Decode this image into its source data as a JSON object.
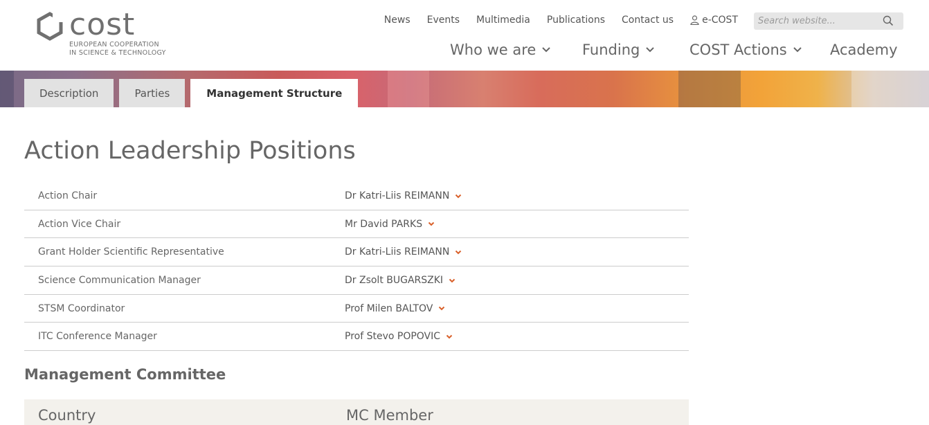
{
  "logo": {
    "wordmark": "cost",
    "subtitle_line1": "EUROPEAN COOPERATION",
    "subtitle_line2": "IN SCIENCE & TECHNOLOGY"
  },
  "topnav": {
    "items": [
      "News",
      "Events",
      "Multimedia",
      "Publications",
      "Contact us"
    ],
    "ecost": "e-COST"
  },
  "search": {
    "placeholder": "Search website..."
  },
  "mainnav": {
    "items": [
      {
        "label": "Who we are",
        "dropdown": true
      },
      {
        "label": "Funding",
        "dropdown": true
      },
      {
        "label": "COST Actions",
        "dropdown": true
      },
      {
        "label": "Academy",
        "dropdown": false
      }
    ]
  },
  "tabs": [
    {
      "label": "Description",
      "active": false
    },
    {
      "label": "Parties",
      "active": false
    },
    {
      "label": "Management Structure",
      "active": true
    }
  ],
  "page_title": "Action Leadership Positions",
  "positions": [
    {
      "role": "Action Chair",
      "person": "Dr Katri-Liis REIMANN"
    },
    {
      "role": "Action Vice Chair",
      "person": "Mr David PARKS"
    },
    {
      "role": "Grant Holder Scientific Representative",
      "person": "Dr Katri-Liis REIMANN"
    },
    {
      "role": "Science Communication Manager",
      "person": "Dr Zsolt BUGARSZKI"
    },
    {
      "role": "STSM Coordinator",
      "person": "Prof Milen BALTOV"
    },
    {
      "role": "ITC Conference Manager",
      "person": "Prof Stevo POPOVIC"
    }
  ],
  "mc_heading": "Management Committee",
  "mc_table": {
    "col_country": "Country",
    "col_member": "MC Member"
  },
  "colors": {
    "accent": "#d9602a",
    "text": "#555555",
    "tab_bg": "#e2e2e2",
    "table_head_bg": "#f3f1ec"
  }
}
